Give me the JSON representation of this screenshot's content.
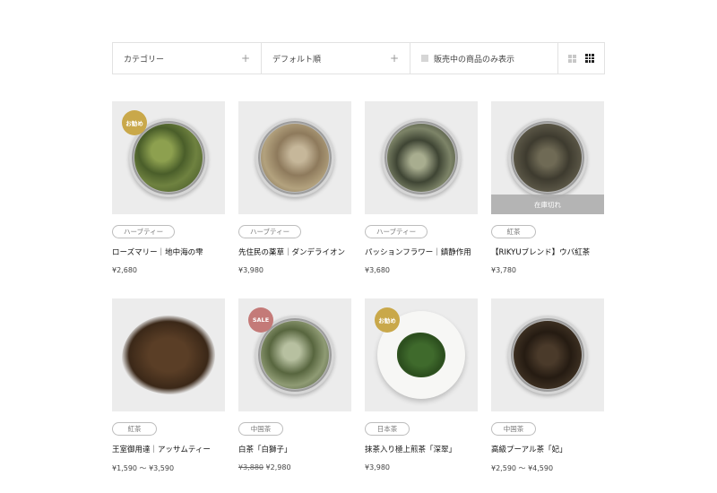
{
  "filters": {
    "category_label": "カテゴリー",
    "sort_label": "デフォルト順",
    "in_stock_label": "販売中の商品のみ表示",
    "plus": "+"
  },
  "colors": {
    "recommend_badge": "#c9a84a",
    "sale_badge": "#c47a78",
    "soldout_overlay": "#aaaaaa",
    "thumb_bg": "#ececec"
  },
  "products": [
    {
      "category": "ハーブティー",
      "name": "ローズマリー｜地中海の雫",
      "price": "¥2,680",
      "badge": "お勧め",
      "badge_type": "rec"
    },
    {
      "category": "ハーブティー",
      "name": "先住民の薬草｜ダンデライオン",
      "price": "¥3,980"
    },
    {
      "category": "ハーブティー",
      "name": "パッションフラワー｜鎮静作用",
      "price": "¥3,680"
    },
    {
      "category": "紅茶",
      "name": "【RIKYUブレンド】ウバ紅茶",
      "price": "¥3,780",
      "overlay": "在庫切れ"
    },
    {
      "category": "紅茶",
      "name": "王室御用達｜アッサムティー",
      "price": "¥1,590 〜 ¥3,590"
    },
    {
      "category": "中国茶",
      "name": "白茶「白獅子」",
      "old_price": "¥3,880",
      "price": "¥2,980",
      "badge": "SALE",
      "badge_type": "sale"
    },
    {
      "category": "日本茶",
      "name": "抹茶入り極上煎茶「深翠」",
      "price": "¥3,980",
      "badge": "お勧め",
      "badge_type": "rec"
    },
    {
      "category": "中国茶",
      "name": "高級プーアル茶「妃」",
      "price": "¥2,590 〜 ¥4,590"
    }
  ]
}
